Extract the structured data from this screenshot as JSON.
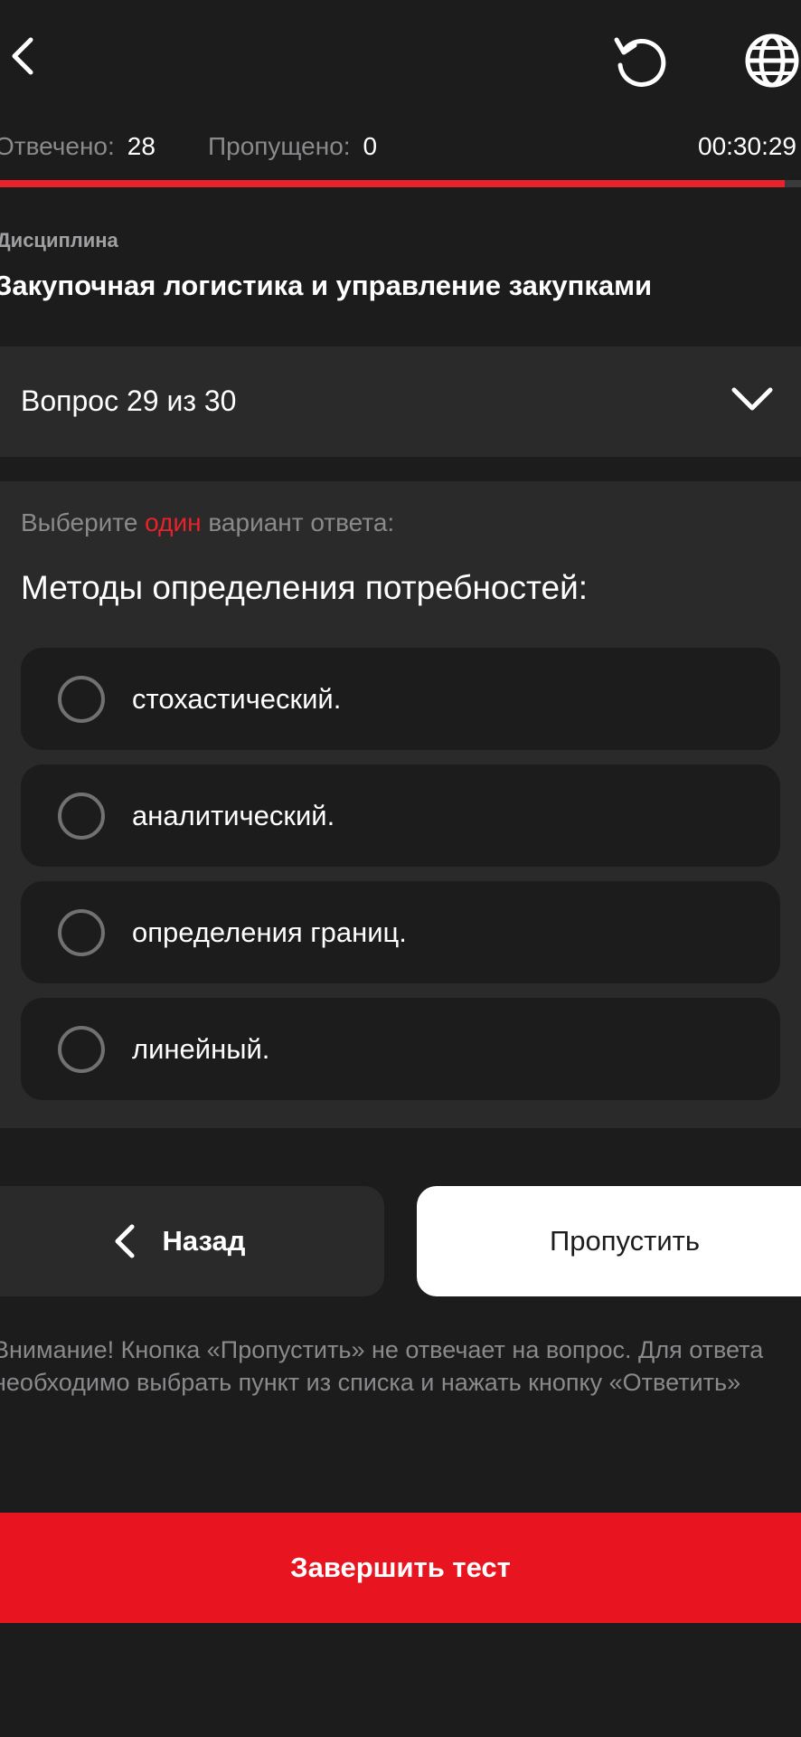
{
  "header": {
    "back_icon": "chevron-left-icon",
    "reset_icon": "refresh-icon",
    "language_icon": "globe-icon"
  },
  "stats": {
    "answered_label": "Отвечено:",
    "answered_value": "28",
    "skipped_label": "Пропущено:",
    "skipped_value": "0",
    "timer": "00:30:29",
    "progress_fraction": 0.98,
    "progress_color": "#e8222a"
  },
  "discipline": {
    "label": "Дисциплина",
    "name": "Закупочная логистика и управление закупками"
  },
  "question_selector": {
    "label": "Вопрос 29 из 30",
    "icon": "chevron-down-icon"
  },
  "question": {
    "instruction_prefix": "Выберите",
    "instruction_highlight": "один",
    "instruction_suffix": "вариант ответа:",
    "text": "Методы определения потребностей:",
    "options": [
      "стохастический.",
      "аналитический.",
      "определения границ.",
      "линейный."
    ]
  },
  "actions": {
    "back_label": "Назад",
    "skip_label": "Пропустить",
    "notice": "Внимание! Кнопка «Пропустить» не отвечает на вопрос. Для ответа необходимо выбрать пункт из списка и нажать кнопку «Ответить»",
    "finish_label": "Завершить тест"
  },
  "colors": {
    "accent": "#e8141f",
    "background": "#1c1c1d",
    "card": "#2a2a2b"
  }
}
